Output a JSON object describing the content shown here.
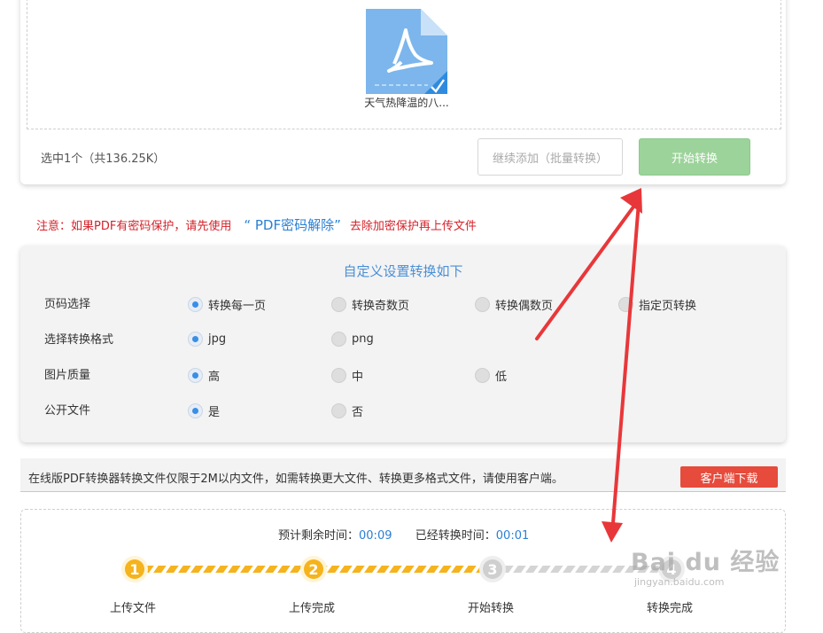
{
  "upload": {
    "file_name": "天气热降温的八...",
    "selected_info": "选中1个（共136.25K）",
    "add_more_label": "继续添加（批量转换）",
    "start_label": "开始转换"
  },
  "notice": {
    "prefix": "注意：如果PDF有密码保护，请先使用",
    "link": "“ PDF密码解除”",
    "suffix": "去除加密保护再上传文件"
  },
  "settings": {
    "title": "自定义设置转换如下",
    "rows": [
      {
        "label": "页码选择",
        "options": [
          "转换每一页",
          "转换奇数页",
          "转换偶数页",
          "指定页转换"
        ],
        "selected": 0
      },
      {
        "label": "选择转换格式",
        "options": [
          "jpg",
          "png"
        ],
        "selected": 0
      },
      {
        "label": "图片质量",
        "options": [
          "高",
          "中",
          "低"
        ],
        "selected": 0
      },
      {
        "label": "公开文件",
        "options": [
          "是",
          "否"
        ],
        "selected": 0
      }
    ]
  },
  "info_bar": {
    "text": "在线版PDF转换器转换文件仅限于2M以内文件，如需转换更大文件、转换更多格式文件，请使用客户端。",
    "download_label": "客户端下载"
  },
  "progress": {
    "remaining_label": "预计剩余时间：",
    "remaining_value": "00:09",
    "elapsed_label": "已经转换时间：",
    "elapsed_value": "00:01",
    "steps": [
      {
        "num": "1",
        "label": "上传文件",
        "done": true
      },
      {
        "num": "2",
        "label": "上传完成",
        "done": true
      },
      {
        "num": "3",
        "label": "开始转换",
        "done": false
      },
      {
        "num": "4",
        "label": "转换完成",
        "done": false
      }
    ]
  },
  "watermark": {
    "brand": "Bai du 经验",
    "site": "jingyan.baidu.com"
  },
  "colors": {
    "accent_blue": "#2a7fd4",
    "start_green": "#9cd39a",
    "notice_red": "#d4222a",
    "download_red": "#e64b3c",
    "step_done": "#f5b31d",
    "annotation_arrow": "#e8373a"
  }
}
